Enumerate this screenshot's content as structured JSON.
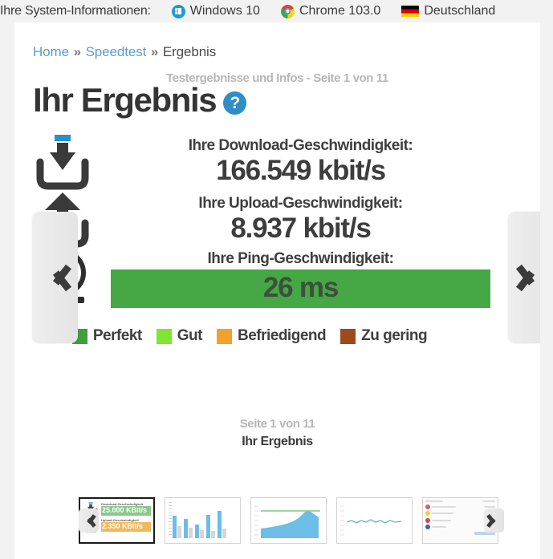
{
  "sysbar": {
    "label": "Ihre System-Informationen:",
    "items": [
      {
        "icon": "windows-icon",
        "text": "Windows 10"
      },
      {
        "icon": "chrome-icon",
        "text": "Chrome 103.0"
      },
      {
        "icon": "german-flag-icon",
        "text": "Deutschland"
      }
    ]
  },
  "breadcrumb": {
    "home": "Home",
    "sep1": "»",
    "speedtest": "Speedtest",
    "sep2": "»",
    "current": "Ergebnis"
  },
  "header": {
    "subtitle": "Testergebnisse und Infos - Seite 1 von 11",
    "title": "Ihr Ergebnis",
    "help_icon_label": "?"
  },
  "results": {
    "download": {
      "icon": "download-arrow-icon",
      "label": "Ihre Download-Geschwindigkeit:",
      "value": "166.549 kbit/s"
    },
    "upload": {
      "icon": "upload-arrow-icon",
      "label": "Ihre Upload-Geschwindigkeit:",
      "value": "8.937 kbit/s"
    },
    "ping": {
      "icon": "speed-gauge-icon",
      "label": "Ihre Ping-Geschwindigkeit:",
      "value": "26 ms",
      "bar_color": "#45a845"
    }
  },
  "legend": [
    {
      "label": "Perfekt",
      "color": "#3f9e3f"
    },
    {
      "label": "Gut",
      "color": "#7de62e"
    },
    {
      "label": "Befriedigend",
      "color": "#f2a22c"
    },
    {
      "label": "Zu gering",
      "color": "#9c4a1e"
    }
  ],
  "carousel": {
    "prev_icon": "chevron-left-icon",
    "next_icon": "chevron-right-icon",
    "page_count": "Seite 1 von 11",
    "page_name": "Ihr Ergebnis",
    "strip_prev_icon": "chevron-left-icon",
    "strip_next_icon": "chevron-right-icon",
    "thumbnails": [
      {
        "name": "thumb-ihr-ergebnis",
        "active": true,
        "download_caption": "Download-Geschwindigkeit",
        "download_value": "25.000 KBit/s",
        "upload_caption": "Upload-Geschwindigkeit",
        "upload_value": "2.350 KBit/s"
      },
      {
        "name": "thumb-bar-chart",
        "active": false
      },
      {
        "name": "thumb-area-chart",
        "active": false
      },
      {
        "name": "thumb-line-chart",
        "active": false
      },
      {
        "name": "thumb-table",
        "active": false
      }
    ]
  }
}
